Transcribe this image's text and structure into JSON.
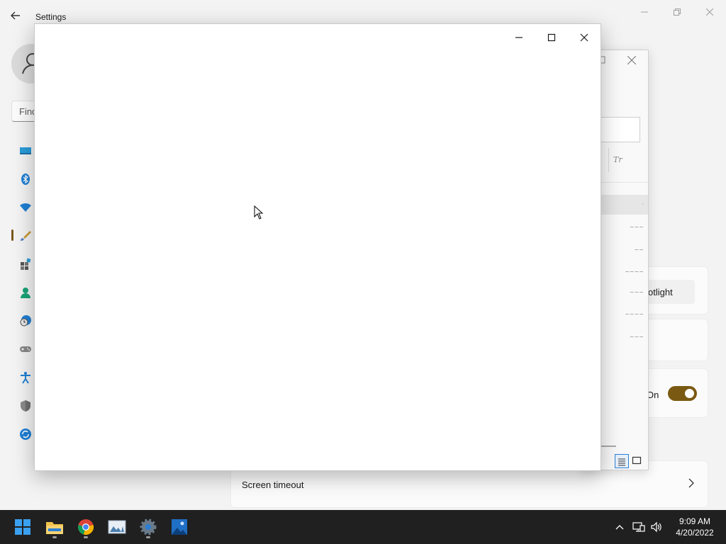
{
  "settings": {
    "window_title": "Settings",
    "search_placeholder": "Find",
    "nav": [
      {
        "icon": "display-system-icon"
      },
      {
        "icon": "bluetooth-icon"
      },
      {
        "icon": "wifi-network-icon"
      },
      {
        "icon": "personalization-brush-icon",
        "selected": true
      },
      {
        "icon": "apps-icon"
      },
      {
        "icon": "accounts-person-icon"
      },
      {
        "icon": "time-language-icon"
      },
      {
        "icon": "gaming-controller-icon"
      },
      {
        "icon": "accessibility-icon"
      },
      {
        "icon": "privacy-shield-icon"
      },
      {
        "icon": "windows-update-icon"
      }
    ],
    "cards": {
      "spotlight_text": "otlight",
      "toggle_state_label": "On",
      "screen_timeout_label": "Screen timeout"
    }
  },
  "taskbar": {
    "apps": [
      {
        "name": "start",
        "icon": "windows-start-icon"
      },
      {
        "name": "file-explorer",
        "icon": "folder-icon"
      },
      {
        "name": "chrome",
        "icon": "chrome-icon"
      },
      {
        "name": "photos",
        "icon": "photo-gallery-icon"
      },
      {
        "name": "settings",
        "icon": "gear-icon"
      },
      {
        "name": "photos-2",
        "icon": "landscape-picture-icon"
      }
    ],
    "time": "9:09 AM",
    "date": "4/20/2022"
  },
  "colors": {
    "accent": "#7a5a12",
    "taskbar_bg": "#202020",
    "window_bg": "#f3f3f3"
  }
}
